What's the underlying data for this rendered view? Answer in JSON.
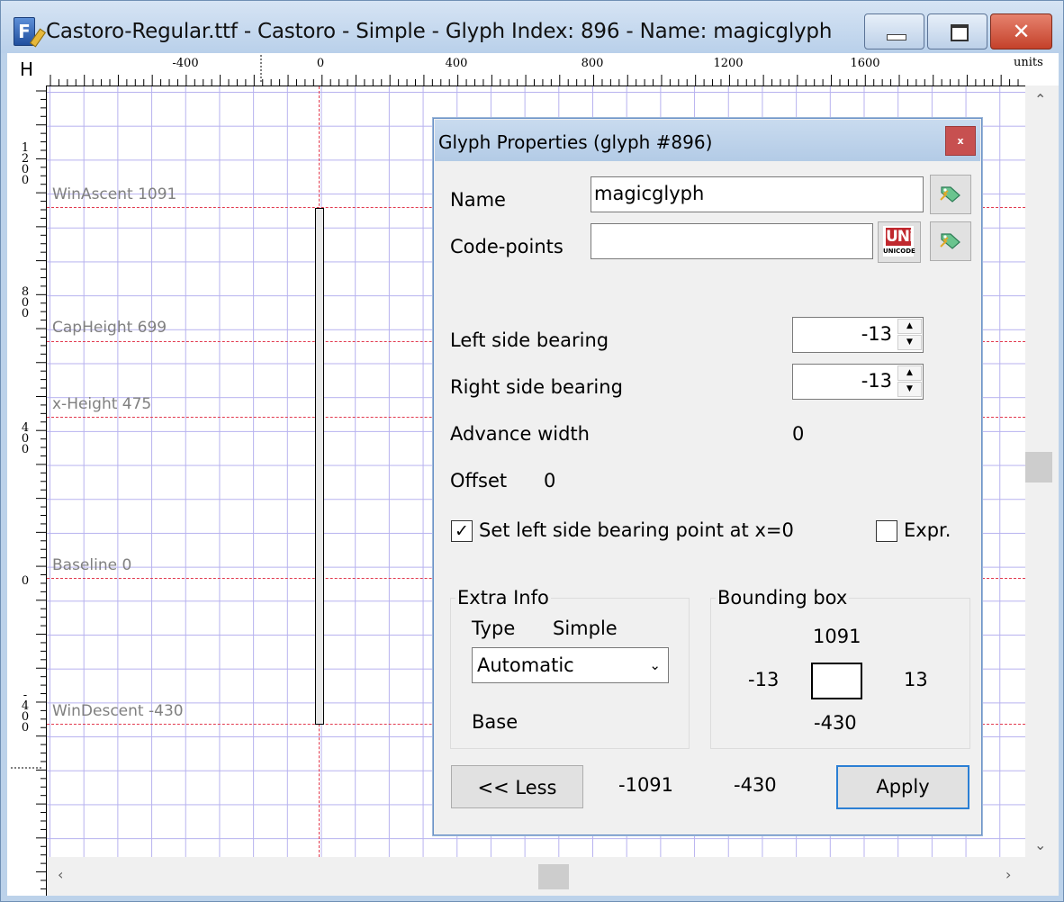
{
  "window": {
    "title": "Castoro-Regular.ttf - Castoro - Simple - Glyph Index: 896 - Name: magicglyph",
    "min_label": "",
    "max_label": "",
    "close_label": "✕"
  },
  "ruler": {
    "corner": "H",
    "units": "units",
    "top_labels": [
      "-400",
      "0",
      "400",
      "800",
      "1200",
      "1600"
    ],
    "left_labels": [
      "1200",
      "800",
      "400",
      "0",
      "-400"
    ]
  },
  "canvas": {
    "metrics": [
      {
        "label": "WinAscent 1091"
      },
      {
        "label": "CapHeight 699"
      },
      {
        "label": "x-Height 475"
      },
      {
        "label": "Baseline 0"
      },
      {
        "label": "WinDescent -430"
      }
    ]
  },
  "dialog": {
    "title": "Glyph Properties (glyph #896)",
    "close_label": "x",
    "name_label": "Name",
    "name_value": "magicglyph",
    "codepoints_label": "Code-points",
    "codepoints_value": "",
    "unicode_icon_top": "UNi",
    "unicode_icon_bottom": "UNICODE",
    "lsb_label": "Left side bearing",
    "lsb_value": "-13",
    "rsb_label": "Right side bearing",
    "rsb_value": "-13",
    "advance_label": "Advance width",
    "advance_value": "0",
    "offset_label": "Offset",
    "offset_value": "0",
    "set_lsb_label": "Set left side bearing point at x=0",
    "set_lsb_checked": true,
    "expr_label": "Expr.",
    "expr_checked": false,
    "extra_info": {
      "title": "Extra Info",
      "type_label": "Type",
      "type_value": "Simple",
      "select_value": "Automatic",
      "base_label": "Base"
    },
    "bounding_box": {
      "title": "Bounding box",
      "top": "1091",
      "left": "-13",
      "right": "13",
      "bottom": "-430"
    },
    "less_button": "<< Less",
    "footer_value_1": "-1091",
    "footer_value_2": "-430",
    "apply_button": "Apply"
  },
  "colors": {
    "grid": "#b7b2ef",
    "guide": "#e23a4f",
    "metric_label": "#808080",
    "accent": "#2b7fd4"
  }
}
